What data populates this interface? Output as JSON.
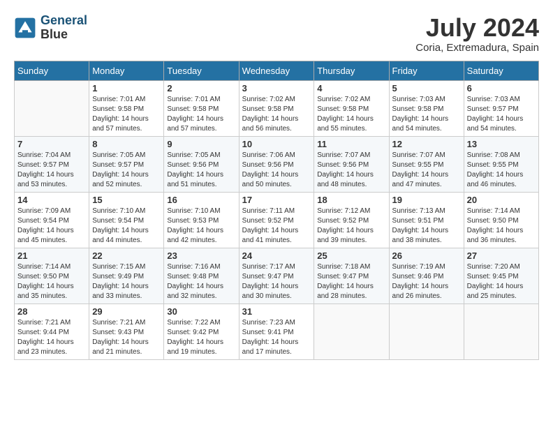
{
  "header": {
    "logo_line1": "General",
    "logo_line2": "Blue",
    "month_year": "July 2024",
    "location": "Coria, Extremadura, Spain"
  },
  "columns": [
    "Sunday",
    "Monday",
    "Tuesday",
    "Wednesday",
    "Thursday",
    "Friday",
    "Saturday"
  ],
  "weeks": [
    [
      {
        "day": "",
        "info": ""
      },
      {
        "day": "1",
        "info": "Sunrise: 7:01 AM\nSunset: 9:58 PM\nDaylight: 14 hours\nand 57 minutes."
      },
      {
        "day": "2",
        "info": "Sunrise: 7:01 AM\nSunset: 9:58 PM\nDaylight: 14 hours\nand 57 minutes."
      },
      {
        "day": "3",
        "info": "Sunrise: 7:02 AM\nSunset: 9:58 PM\nDaylight: 14 hours\nand 56 minutes."
      },
      {
        "day": "4",
        "info": "Sunrise: 7:02 AM\nSunset: 9:58 PM\nDaylight: 14 hours\nand 55 minutes."
      },
      {
        "day": "5",
        "info": "Sunrise: 7:03 AM\nSunset: 9:58 PM\nDaylight: 14 hours\nand 54 minutes."
      },
      {
        "day": "6",
        "info": "Sunrise: 7:03 AM\nSunset: 9:57 PM\nDaylight: 14 hours\nand 54 minutes."
      }
    ],
    [
      {
        "day": "7",
        "info": "Sunrise: 7:04 AM\nSunset: 9:57 PM\nDaylight: 14 hours\nand 53 minutes."
      },
      {
        "day": "8",
        "info": "Sunrise: 7:05 AM\nSunset: 9:57 PM\nDaylight: 14 hours\nand 52 minutes."
      },
      {
        "day": "9",
        "info": "Sunrise: 7:05 AM\nSunset: 9:56 PM\nDaylight: 14 hours\nand 51 minutes."
      },
      {
        "day": "10",
        "info": "Sunrise: 7:06 AM\nSunset: 9:56 PM\nDaylight: 14 hours\nand 50 minutes."
      },
      {
        "day": "11",
        "info": "Sunrise: 7:07 AM\nSunset: 9:56 PM\nDaylight: 14 hours\nand 48 minutes."
      },
      {
        "day": "12",
        "info": "Sunrise: 7:07 AM\nSunset: 9:55 PM\nDaylight: 14 hours\nand 47 minutes."
      },
      {
        "day": "13",
        "info": "Sunrise: 7:08 AM\nSunset: 9:55 PM\nDaylight: 14 hours\nand 46 minutes."
      }
    ],
    [
      {
        "day": "14",
        "info": "Sunrise: 7:09 AM\nSunset: 9:54 PM\nDaylight: 14 hours\nand 45 minutes."
      },
      {
        "day": "15",
        "info": "Sunrise: 7:10 AM\nSunset: 9:54 PM\nDaylight: 14 hours\nand 44 minutes."
      },
      {
        "day": "16",
        "info": "Sunrise: 7:10 AM\nSunset: 9:53 PM\nDaylight: 14 hours\nand 42 minutes."
      },
      {
        "day": "17",
        "info": "Sunrise: 7:11 AM\nSunset: 9:52 PM\nDaylight: 14 hours\nand 41 minutes."
      },
      {
        "day": "18",
        "info": "Sunrise: 7:12 AM\nSunset: 9:52 PM\nDaylight: 14 hours\nand 39 minutes."
      },
      {
        "day": "19",
        "info": "Sunrise: 7:13 AM\nSunset: 9:51 PM\nDaylight: 14 hours\nand 38 minutes."
      },
      {
        "day": "20",
        "info": "Sunrise: 7:14 AM\nSunset: 9:50 PM\nDaylight: 14 hours\nand 36 minutes."
      }
    ],
    [
      {
        "day": "21",
        "info": "Sunrise: 7:14 AM\nSunset: 9:50 PM\nDaylight: 14 hours\nand 35 minutes."
      },
      {
        "day": "22",
        "info": "Sunrise: 7:15 AM\nSunset: 9:49 PM\nDaylight: 14 hours\nand 33 minutes."
      },
      {
        "day": "23",
        "info": "Sunrise: 7:16 AM\nSunset: 9:48 PM\nDaylight: 14 hours\nand 32 minutes."
      },
      {
        "day": "24",
        "info": "Sunrise: 7:17 AM\nSunset: 9:47 PM\nDaylight: 14 hours\nand 30 minutes."
      },
      {
        "day": "25",
        "info": "Sunrise: 7:18 AM\nSunset: 9:47 PM\nDaylight: 14 hours\nand 28 minutes."
      },
      {
        "day": "26",
        "info": "Sunrise: 7:19 AM\nSunset: 9:46 PM\nDaylight: 14 hours\nand 26 minutes."
      },
      {
        "day": "27",
        "info": "Sunrise: 7:20 AM\nSunset: 9:45 PM\nDaylight: 14 hours\nand 25 minutes."
      }
    ],
    [
      {
        "day": "28",
        "info": "Sunrise: 7:21 AM\nSunset: 9:44 PM\nDaylight: 14 hours\nand 23 minutes."
      },
      {
        "day": "29",
        "info": "Sunrise: 7:21 AM\nSunset: 9:43 PM\nDaylight: 14 hours\nand 21 minutes."
      },
      {
        "day": "30",
        "info": "Sunrise: 7:22 AM\nSunset: 9:42 PM\nDaylight: 14 hours\nand 19 minutes."
      },
      {
        "day": "31",
        "info": "Sunrise: 7:23 AM\nSunset: 9:41 PM\nDaylight: 14 hours\nand 17 minutes."
      },
      {
        "day": "",
        "info": ""
      },
      {
        "day": "",
        "info": ""
      },
      {
        "day": "",
        "info": ""
      }
    ]
  ]
}
